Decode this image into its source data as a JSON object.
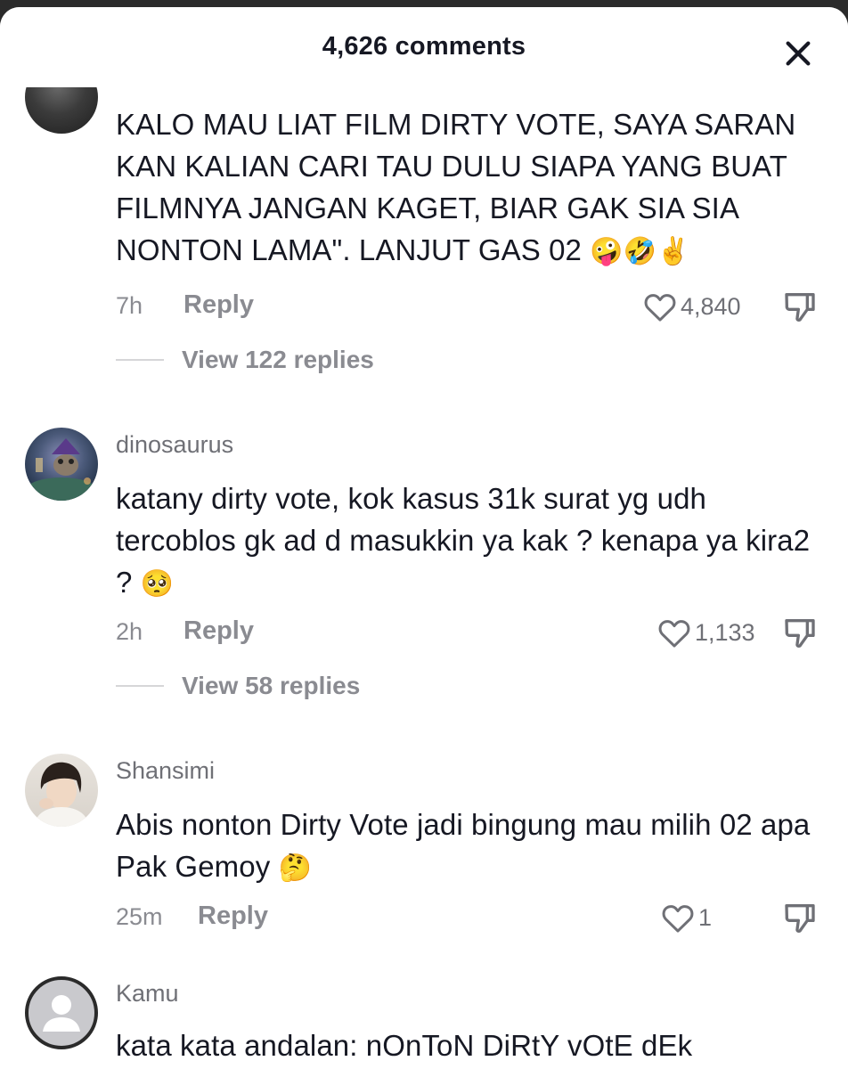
{
  "header": {
    "title": "4,626 comments",
    "close_icon": "close-icon"
  },
  "comments": [
    {
      "username": "",
      "text": "KALO MAU LIAT FILM DIRTY VOTE, SAYA SARAN KAN KALIAN CARI TAU DULU SIAPA YANG BUAT FILMNYA JANGAN KAGET, BIAR GAK SIA SIA NONTON LAMA\". LANJUT GAS 02",
      "emoji": "🤪🤣✌️",
      "time": "7h",
      "reply_label": "Reply",
      "likes": "4,840",
      "view_replies": "View 122 replies"
    },
    {
      "username": "dinosaurus",
      "text": "katany dirty vote, kok kasus 31k surat yg udh tercoblos gk ad d masukkin ya kak ? kenapa ya kira2 ?",
      "emoji": "🥺",
      "time": "2h",
      "reply_label": "Reply",
      "likes": "1,133",
      "view_replies": "View 58 replies"
    },
    {
      "username": "Shansimi",
      "text": "Abis nonton Dirty Vote jadi bingung mau milih 02 apa Pak Gemoy",
      "emoji": "🤔",
      "time": "25m",
      "reply_label": "Reply",
      "likes": "1"
    },
    {
      "username": "Kamu",
      "text": "kata kata andalan: nOnToN DiRtY vOtE dEk"
    }
  ],
  "colors": {
    "text": "#161823",
    "muted": "#8a8b91",
    "background": "#ffffff"
  }
}
